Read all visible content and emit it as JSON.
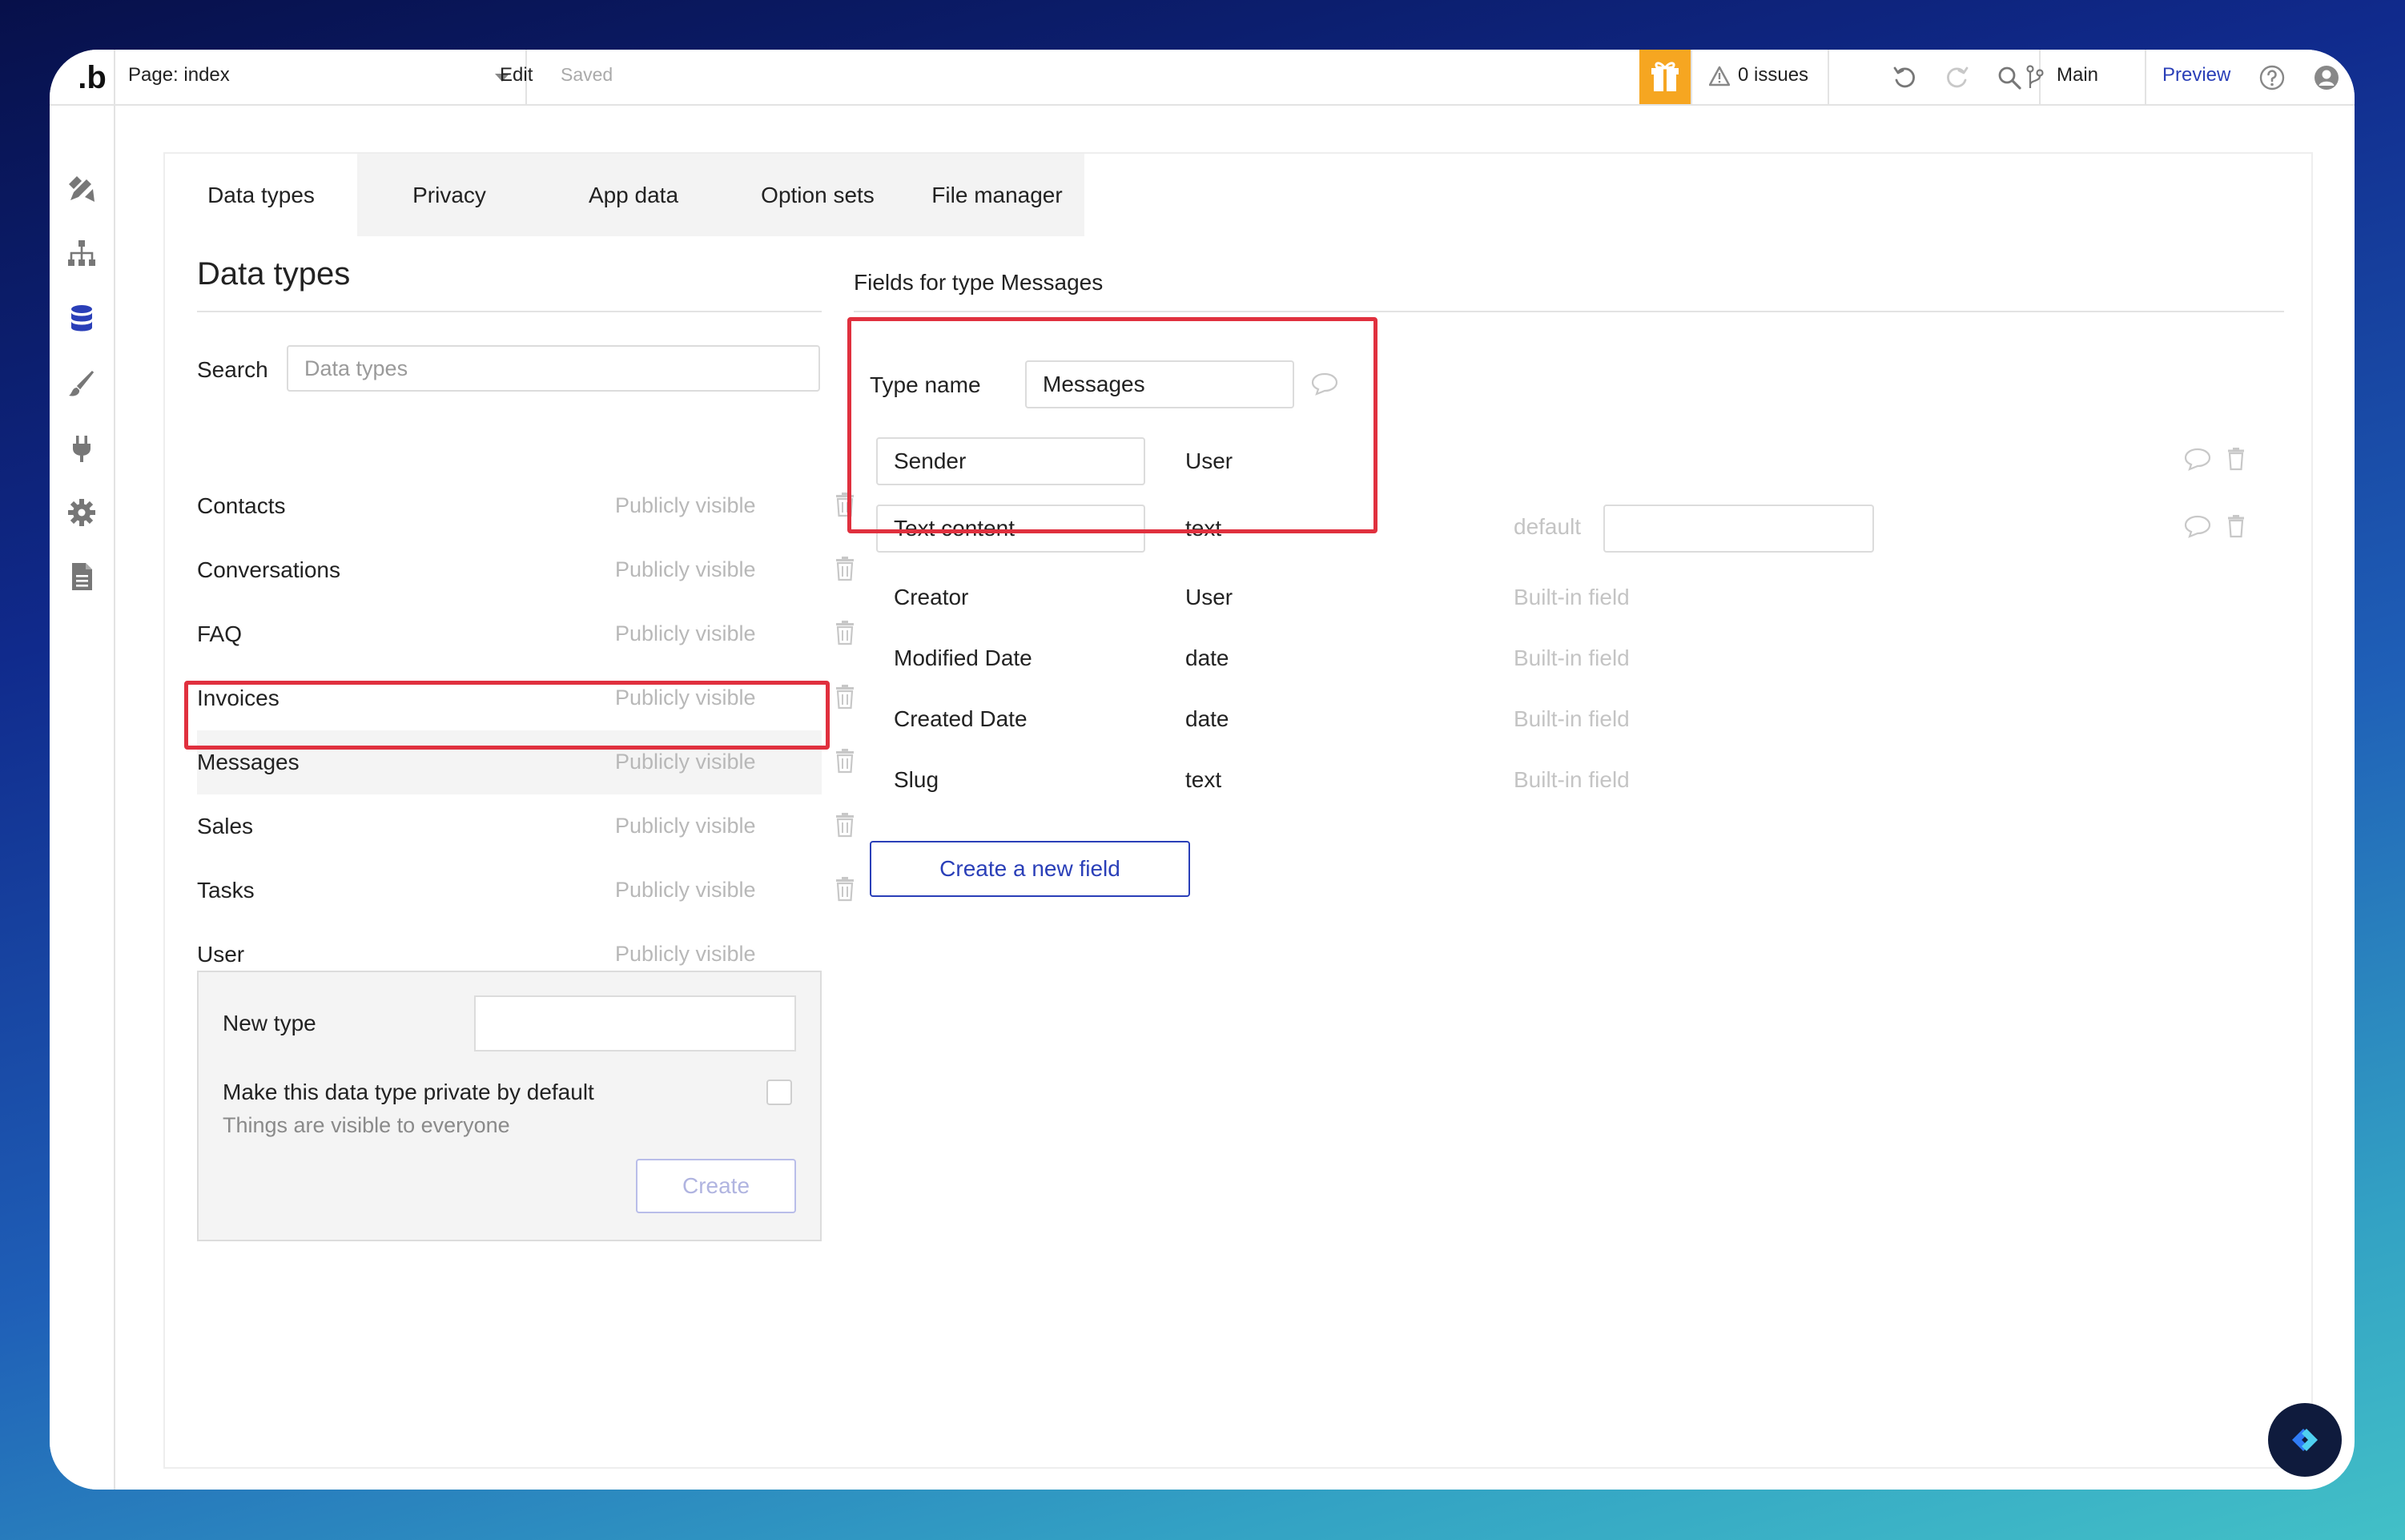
{
  "topbar": {
    "logo": ".b",
    "page_label": "Page: index",
    "edit": "Edit",
    "saved": "Saved",
    "issues": "0 issues",
    "branch": "Main",
    "preview": "Preview",
    "icons": [
      "gift-icon",
      "warning-icon",
      "undo-icon",
      "redo-icon",
      "search-icon",
      "branch-icon",
      "help-icon",
      "account-icon"
    ]
  },
  "rail": {
    "icons": [
      "design-icon",
      "workflow-icon",
      "data-icon",
      "styles-icon",
      "plugins-icon",
      "settings-icon",
      "logs-icon"
    ]
  },
  "tabs": [
    {
      "label": "Data types"
    },
    {
      "label": "Privacy"
    },
    {
      "label": "App data"
    },
    {
      "label": "Option sets"
    },
    {
      "label": "File manager"
    }
  ],
  "left": {
    "title": "Data types",
    "search_label": "Search",
    "search_placeholder": "Data types",
    "types": [
      {
        "name": "Contacts",
        "visibility": "Publicly visible"
      },
      {
        "name": "Conversations",
        "visibility": "Publicly visible"
      },
      {
        "name": "FAQ",
        "visibility": "Publicly visible"
      },
      {
        "name": "Invoices",
        "visibility": "Publicly visible"
      },
      {
        "name": "Messages",
        "visibility": "Publicly visible"
      },
      {
        "name": "Sales",
        "visibility": "Publicly visible"
      },
      {
        "name": "Tasks",
        "visibility": "Publicly visible"
      },
      {
        "name": "User",
        "visibility": "Publicly visible"
      }
    ],
    "new_type": {
      "label": "New type",
      "private_label": "Make this data type private by default",
      "visibility_note": "Things are visible to everyone",
      "create_label": "Create"
    }
  },
  "right": {
    "title": "Fields for type Messages",
    "type_name_label": "Type name",
    "type_name_value": "Messages",
    "default_label": "default",
    "editable_fields": [
      {
        "name": "Sender",
        "type": "User"
      },
      {
        "name": "Text content",
        "type": "text"
      }
    ],
    "builtin_fields": [
      {
        "name": "Creator",
        "type": "User",
        "note": "Built-in field"
      },
      {
        "name": "Modified Date",
        "type": "date",
        "note": "Built-in field"
      },
      {
        "name": "Created Date",
        "type": "date",
        "note": "Built-in field"
      },
      {
        "name": "Slug",
        "type": "text",
        "note": "Built-in field"
      }
    ],
    "create_field_label": "Create a new field"
  },
  "colors": {
    "accent": "#2a3fb8",
    "highlight": "#e0303e",
    "gift": "#f6a621"
  }
}
